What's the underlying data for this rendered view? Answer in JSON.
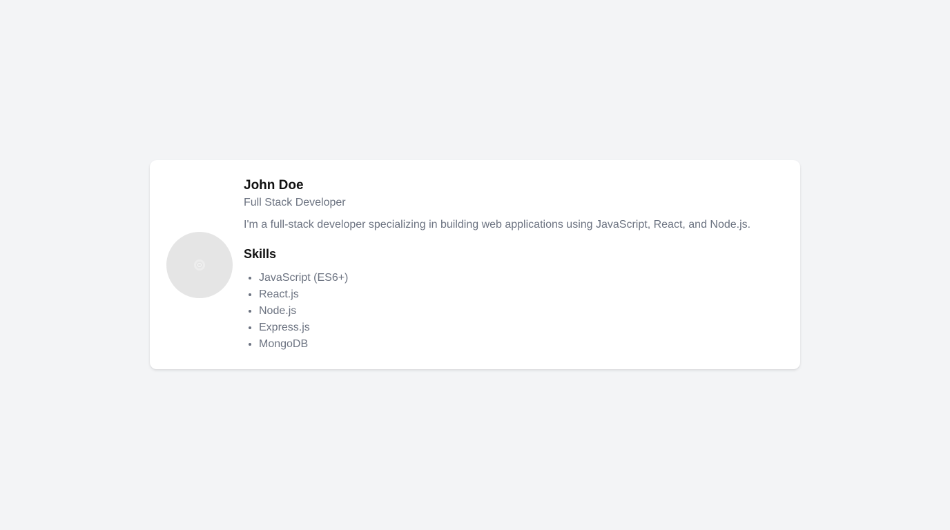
{
  "profile": {
    "avatar_icon": "loading-spinner-icon",
    "name": "John Doe",
    "title": "Full Stack Developer",
    "bio": "I'm a full-stack developer specializing in building web applications using JavaScript, React, and Node.js."
  },
  "skills": {
    "heading": "Skills",
    "items": [
      "JavaScript (ES6+)",
      "React.js",
      "Node.js",
      "Express.js",
      "MongoDB"
    ]
  },
  "colors": {
    "background": "#f3f4f6",
    "card": "#ffffff",
    "heading_text": "#111111",
    "muted_text": "#6b7280",
    "avatar_placeholder": "#e5e5e5"
  }
}
